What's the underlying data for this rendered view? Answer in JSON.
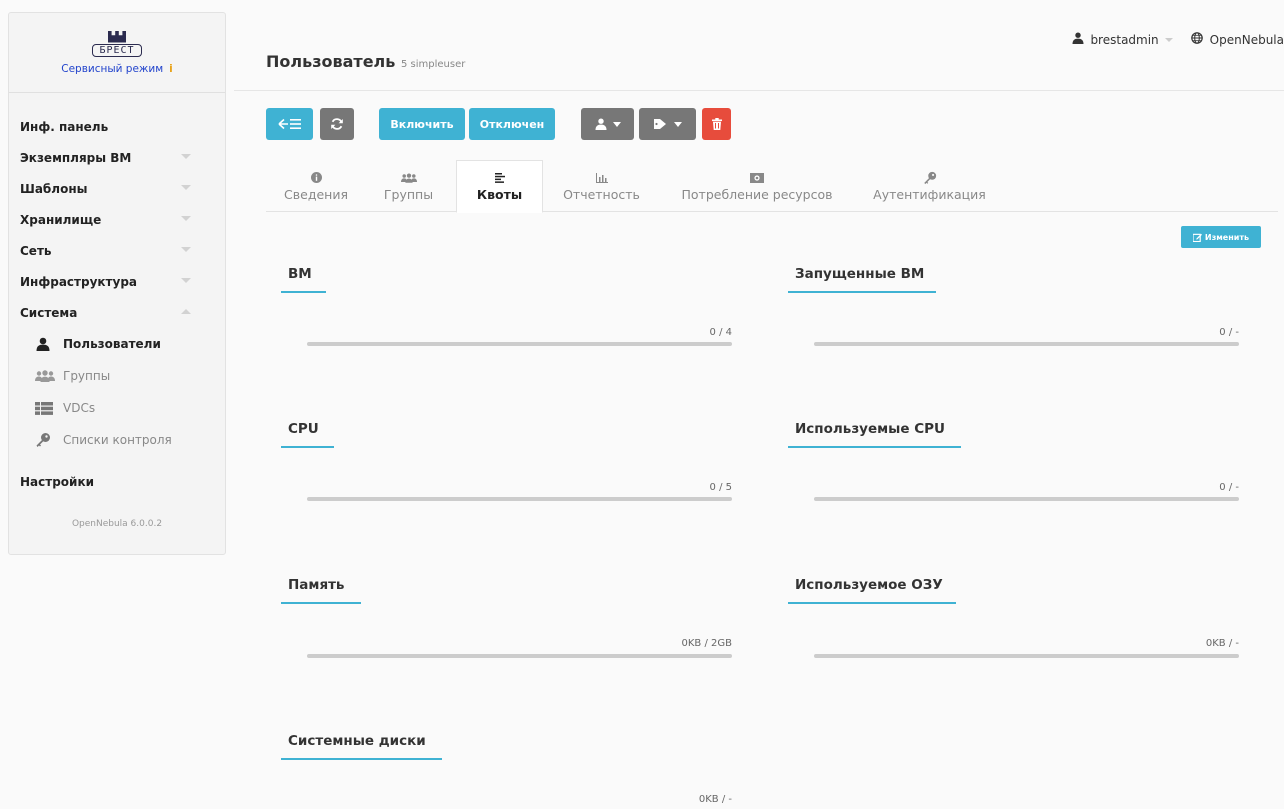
{
  "sidebar": {
    "logo_text": "БРЕСТ",
    "mode_label": "Сервисный режим",
    "mode_info": "i",
    "items": [
      {
        "label": "Инф. панель"
      },
      {
        "label": "Экземпляры ВМ"
      },
      {
        "label": "Шаблоны"
      },
      {
        "label": "Хранилище"
      },
      {
        "label": "Сеть"
      },
      {
        "label": "Инфраструктура"
      },
      {
        "label": "Система"
      }
    ],
    "sub_items": [
      {
        "label": "Пользователи"
      },
      {
        "label": "Группы"
      },
      {
        "label": "VDCs"
      },
      {
        "label": "Списки контроля"
      }
    ],
    "settings_label": "Настройки",
    "version": "OpenNebula 6.0.0.2"
  },
  "header": {
    "title": "Пользователь",
    "subtitle": "5 simpleuser",
    "user_name": "brestadmin",
    "zone_name": "OpenNebula"
  },
  "toolbar": {
    "enable_label": "Включить",
    "disable_label": "Отключен"
  },
  "tabs": [
    {
      "label": "Сведения"
    },
    {
      "label": "Группы"
    },
    {
      "label": "Квоты"
    },
    {
      "label": "Отчетность"
    },
    {
      "label": "Потребление ресурсов"
    },
    {
      "label": "Аутентификация"
    }
  ],
  "edit_label": "Изменить",
  "quotas": {
    "vm": {
      "title": "ВМ",
      "value": "0 / 4"
    },
    "running_vm": {
      "title": "Запущенные ВМ",
      "value": "0 / -"
    },
    "cpu": {
      "title": "CPU",
      "value": "0 / 5"
    },
    "used_cpu": {
      "title": "Используемые CPU",
      "value": "0 / -"
    },
    "memory": {
      "title": "Память",
      "value": "0KB / 2GB"
    },
    "used_ram": {
      "title": "Используемое ОЗУ",
      "value": "0KB / -"
    },
    "system_disks": {
      "title": "Системные диски",
      "value": "0KB / -"
    }
  },
  "colors": {
    "accent": "#3fb2d3",
    "danger": "#e74c3c",
    "toolbar_gray": "#777777"
  }
}
